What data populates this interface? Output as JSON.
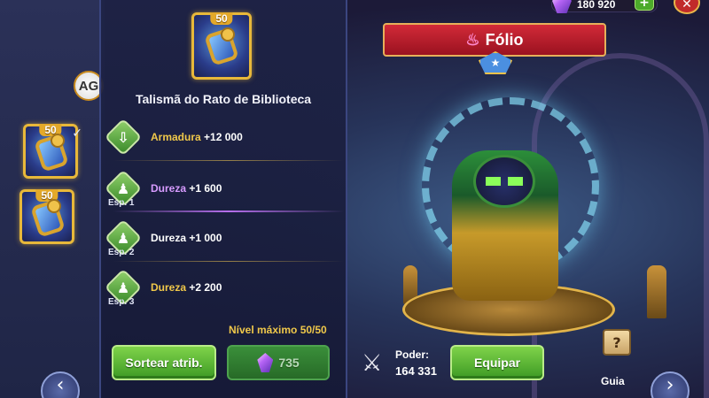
{
  "item": {
    "title": "Talismã do Rato de Biblioteca",
    "level": "50",
    "max_level_text": "Nível máximo 50/50"
  },
  "watermark": {
    "text": "AG"
  },
  "side_items": [
    {
      "level": "50",
      "equipped": true
    },
    {
      "level": "50",
      "equipped": false
    }
  ],
  "stats": [
    {
      "name": "Armadura",
      "value": "+12 000",
      "name_color": "#f0c84a",
      "icon": "shield-down-icon",
      "slot": ""
    },
    {
      "name": "Dureza",
      "value": "+1 600",
      "name_color": "#d79bff",
      "icon": "hero-silhouette-icon",
      "slot": "Esp. 1"
    },
    {
      "name": "Dureza",
      "value": "+1 000",
      "name_color": "#ffffff",
      "icon": "hero-silhouette-icon",
      "slot": "Esp. 2"
    },
    {
      "name": "Dureza",
      "value": "+2 200",
      "name_color": "#f0c84a",
      "icon": "hero-silhouette-icon",
      "slot": "Esp. 3"
    }
  ],
  "buttons": {
    "reroll": "Sortear atrib.",
    "reroll_cost": "735",
    "equip": "Equipar"
  },
  "hero": {
    "name": "Fólio",
    "power_label": "Poder:",
    "power_value": "164 331"
  },
  "guide": {
    "label": "Guia",
    "icon_glyph": "?"
  },
  "top_bar": {
    "gems": "180 920"
  }
}
